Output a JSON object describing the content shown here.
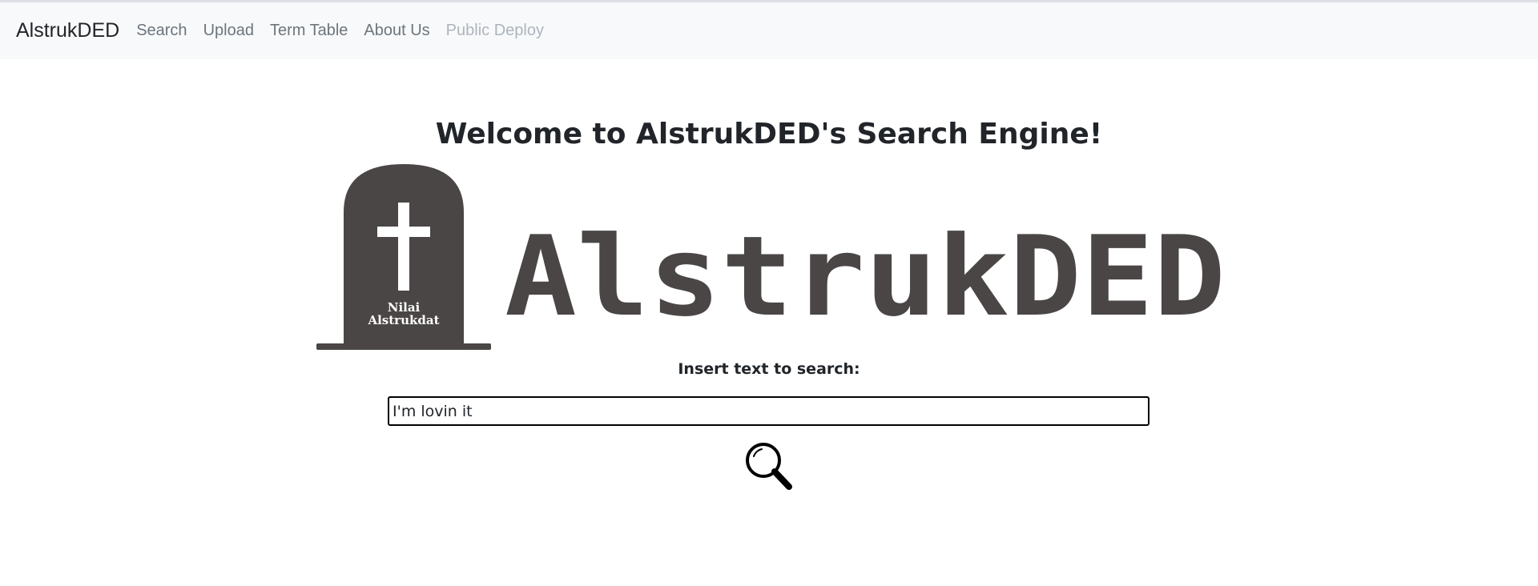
{
  "navbar": {
    "brand": "AlstrukDED",
    "links": [
      {
        "label": "Search",
        "disabled": false
      },
      {
        "label": "Upload",
        "disabled": false
      },
      {
        "label": "Term Table",
        "disabled": false
      },
      {
        "label": "About Us",
        "disabled": false
      },
      {
        "label": "Public Deploy",
        "disabled": true
      }
    ]
  },
  "main": {
    "heading": "Welcome to AlstrukDED's Search Engine!",
    "logo": {
      "wordmark": "AlstrukDED",
      "tombstone_line1": "Nilai",
      "tombstone_line2": "Alstrukdat"
    },
    "search_label": "Insert text to search:",
    "search_value": "I'm lovin it",
    "search_button_icon": "magnifier-icon"
  },
  "colors": {
    "navbar_bg": "#f8f9fa",
    "logo_gray": "#4a4645",
    "text": "#212529",
    "nav_link": "#6c757d",
    "nav_disabled": "#adb5bd"
  }
}
